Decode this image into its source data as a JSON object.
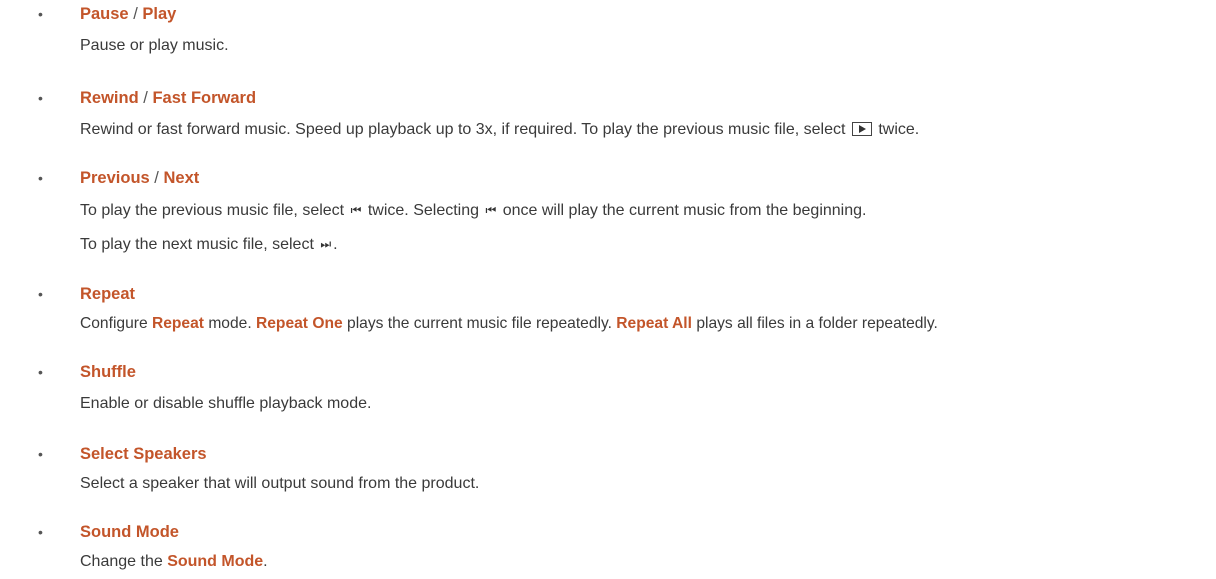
{
  "items": [
    {
      "name": "pause-play",
      "heading": {
        "a": "Pause",
        "sep": "/",
        "b": "Play"
      },
      "lines": [
        "Pause or play music."
      ]
    },
    {
      "name": "rewind-fast-forward",
      "heading": {
        "a": "Rewind",
        "sep": "/",
        "b": "Fast Forward"
      },
      "line1": {
        "t1": "Rewind or fast forward music. Speed up playback up to 3x, if required. To play the previous music file, select",
        "t2": "twice."
      }
    },
    {
      "name": "previous-next",
      "heading": {
        "a": "Previous",
        "sep": "/",
        "b": "Next"
      },
      "line1": {
        "t1": "To play the previous music file, select",
        "t2": "twice. Selecting",
        "t3": "once will play the current music from the beginning."
      },
      "line2": {
        "t1": "To play the next music file, select",
        "t2": "."
      }
    },
    {
      "name": "repeat",
      "heading": {
        "a": "Repeat"
      },
      "line1": {
        "t1": "Configure",
        "b1": "Repeat",
        "t2": "mode.",
        "b2": "Repeat One",
        "t3": "plays the current music file repeatedly.",
        "b3": "Repeat All",
        "t4": "plays all files in a folder repeatedly."
      }
    },
    {
      "name": "shuffle",
      "heading": {
        "a": "Shuffle"
      },
      "lines": [
        "Enable or disable shuffle playback mode."
      ]
    },
    {
      "name": "select-speakers",
      "heading": {
        "a": "Select Speakers"
      },
      "lines": [
        "Select a speaker that will output sound from the product."
      ]
    },
    {
      "name": "sound-mode",
      "heading": {
        "a": "Sound Mode"
      },
      "line1": {
        "t1": "Change the",
        "b1": "Sound Mode",
        "t2": "."
      }
    }
  ],
  "bullet_char": "•",
  "glyphs": {
    "prev": "⏮",
    "next": "⏭"
  }
}
